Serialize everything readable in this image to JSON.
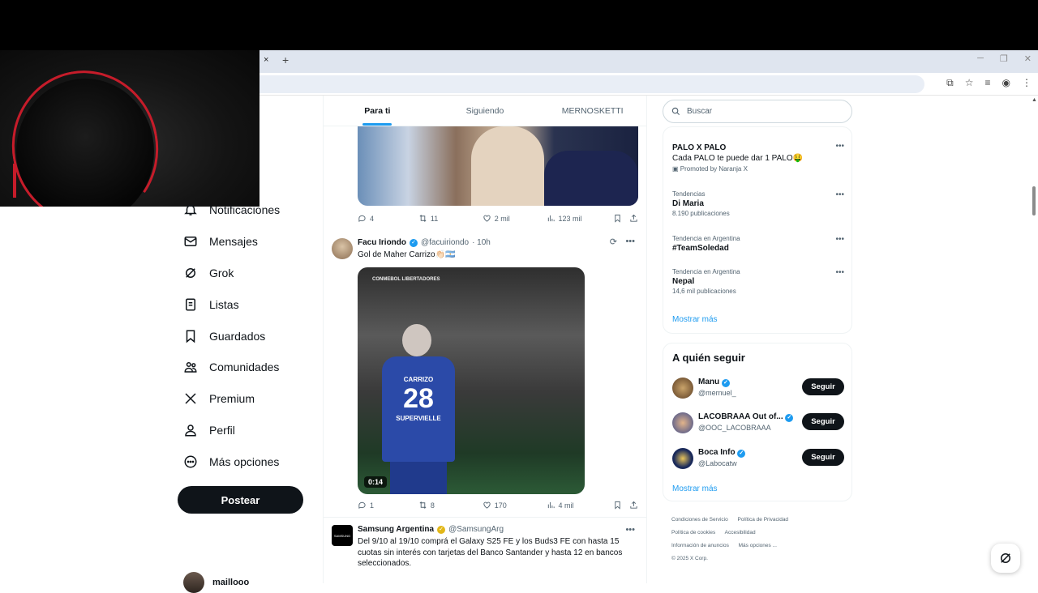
{
  "browser": {
    "tab_close": "×",
    "tab_new": "+"
  },
  "nav": {
    "items": [
      {
        "label": "Notificaciones",
        "icon": "bell-icon"
      },
      {
        "label": "Mensajes",
        "icon": "mail-icon"
      },
      {
        "label": "Grok",
        "icon": "grok-icon"
      },
      {
        "label": "Listas",
        "icon": "list-icon"
      },
      {
        "label": "Guardados",
        "icon": "bookmark-icon"
      },
      {
        "label": "Comunidades",
        "icon": "communities-icon"
      },
      {
        "label": "Premium",
        "icon": "x-logo-icon"
      },
      {
        "label": "Perfil",
        "icon": "person-icon"
      },
      {
        "label": "Más opciones",
        "icon": "more-circle-icon"
      }
    ],
    "post_label": "Postear",
    "account_name": "maillooo"
  },
  "timeline": {
    "tabs": [
      "Para ti",
      "Siguiendo",
      "MERNOSKETTI"
    ],
    "tweet1_actions": {
      "replies": "4",
      "reposts": "11",
      "likes": "2 mil",
      "views": "123 mil"
    },
    "tweet2": {
      "name": "Facu Iriondo",
      "handle": "@facuiriondo",
      "time": "· 10h",
      "text": "Gol de Maher Carrizo👏🏻🇦🇷",
      "video": {
        "brand": "CONMEBOL LIBERTADORES",
        "number": "28",
        "player_name": "CARRIZO",
        "sponsor": "SUPERVIELLE",
        "duration": "0:14"
      },
      "actions": {
        "replies": "1",
        "reposts": "8",
        "likes": "170",
        "views": "4 mil"
      }
    },
    "tweet3": {
      "name": "Samsung Argentina",
      "handle": "@SamsungArg",
      "avatar_text": "SAMSUNG",
      "text": "Del 9/10 al 19/10 comprá el Galaxy S25 FE y los Buds3 FE con hasta 15 cuotas sin interés con tarjetas del Banco Santander y hasta 12 en bancos seleccionados."
    }
  },
  "sidebar": {
    "search_placeholder": "Buscar",
    "trends": [
      {
        "title": "PALO X PALO",
        "desc": "Cada PALO te puede dar 1 PALO🤑",
        "promo": "Promoted by Naranja X"
      },
      {
        "context": "Tendencias",
        "title": "Di Maria",
        "sub": "8.190 publicaciones"
      },
      {
        "context": "Tendencia en Argentina",
        "title": "#TeamSoledad"
      },
      {
        "context": "Tendencia en Argentina",
        "title": "Nepal",
        "sub": "14,6 mil publicaciones"
      }
    ],
    "trends_show_more": "Mostrar más",
    "follow_title": "A quién seguir",
    "follow": [
      {
        "name": "Manu",
        "handle": "@mernuel_",
        "button": "Seguir"
      },
      {
        "name": "LACOBRAAA Out of...",
        "handle": "@OOC_LACOBRAAA",
        "button": "Seguir"
      },
      {
        "name": "Boca Info",
        "handle": "@Labocatw",
        "button": "Seguir"
      }
    ],
    "follow_show_more": "Mostrar más",
    "footer": [
      "Condiciones de Servicio",
      "Política de Privacidad",
      "Política de cookies",
      "Accesibilidad",
      "Información de anuncios",
      "Más opciones ...",
      "© 2025 X Corp."
    ]
  },
  "colors": {
    "accent": "#1d9bf0",
    "text": "#0f1419",
    "muted": "#536471",
    "button_dark": "#0f1419"
  }
}
